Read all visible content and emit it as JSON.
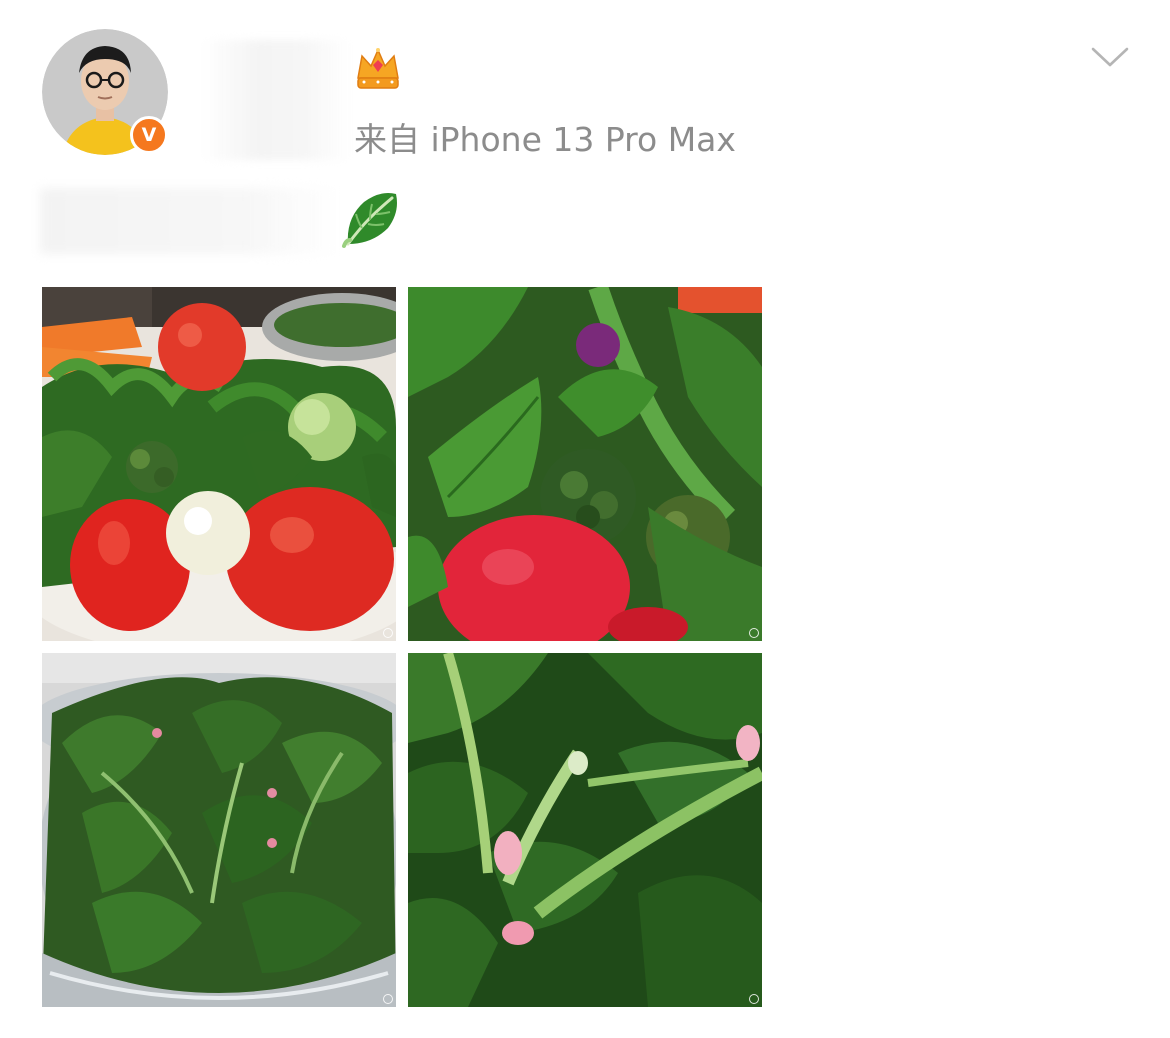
{
  "post": {
    "author": {
      "avatar_icon": "avatar-man-glasses-yellow-shirt",
      "verified_badge": "V",
      "verified_color": "#f5781e",
      "member_icon": "crown-icon"
    },
    "source_text": "来自 iPhone 13 Pro Max",
    "text_emoji_icon": "leafy-green-emoji",
    "menu_icon": "chevron-down-icon",
    "photos": [
      {
        "subject": "tomatoes, parsley, broccoli, carrots"
      },
      {
        "subject": "parsley, broccoli, tomato close-up"
      },
      {
        "subject": "spinach in glass bowl"
      },
      {
        "subject": "spinach leaves close-up"
      }
    ]
  }
}
